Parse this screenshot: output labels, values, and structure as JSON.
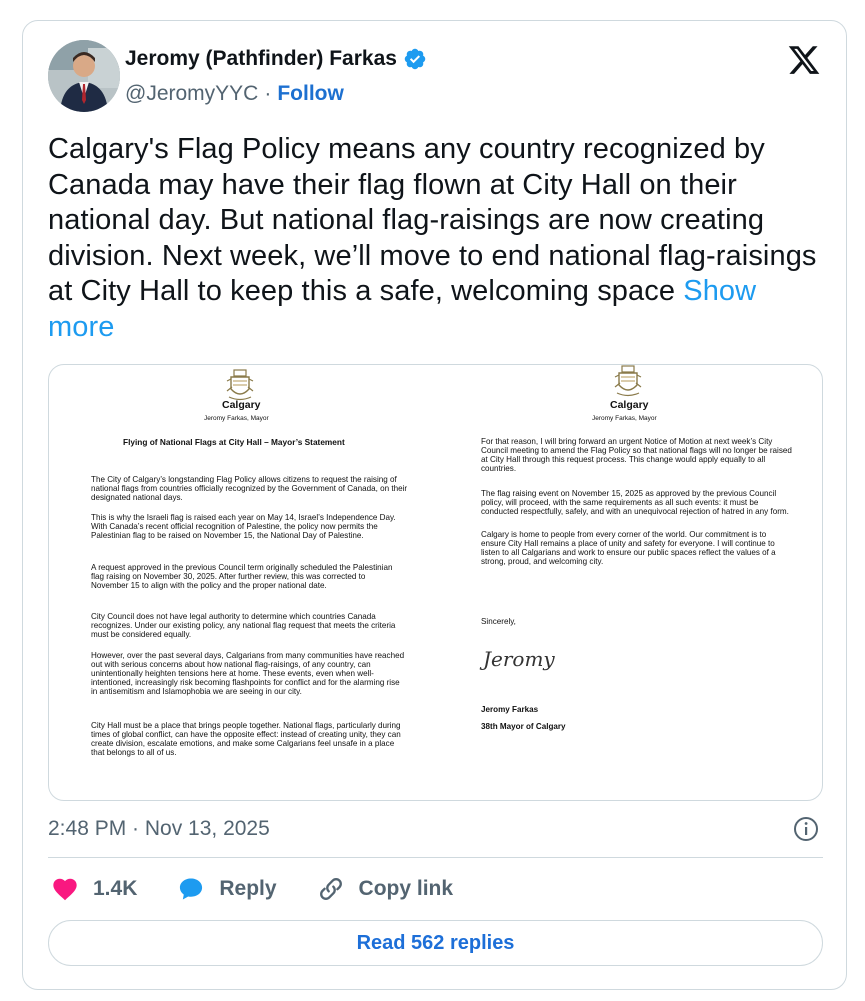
{
  "author": {
    "name": "Jeromy (Pathfinder) Farkas",
    "handle": "@JeromyYYC",
    "separator": "·",
    "follow_label": "Follow"
  },
  "tweet": {
    "text": "Calgary's Flag Policy means any country recognized by Canada may have their flag flown at City Hall on their national day. But national flag-raisings are now creating division. Next week, we’ll move to end national flag-raisings at City Hall to keep this a safe, welcoming space",
    "show_more": "Show more"
  },
  "document": {
    "city": "Calgary",
    "mayor_line": "Jeromy Farkas, Mayor",
    "title": "Flying of National Flags at City Hall – Mayor’s Statement",
    "left_paragraphs": [
      "The City of Calgary’s longstanding Flag Policy allows citizens to request the raising of national flags from countries officially recognized by the Government of Canada, on their designated national days.",
      "This is why the Israeli flag is raised each year on May 14, Israel’s Independence Day. With Canada’s recent official recognition of Palestine, the policy now permits the Palestinian flag to be raised on November 15, the National Day of Palestine.",
      "A request approved in the previous Council term originally scheduled the Palestinian flag raising on November 30, 2025. After further review, this was corrected to November 15 to align with the policy and the proper national date.",
      "City Council does not have legal authority to determine which countries Canada recognizes. Under our existing policy, any national flag request that meets the criteria must be considered equally.",
      "However, over the past several days, Calgarians from many communities have reached out with serious concerns about how national flag-raisings, of any country, can unintentionally heighten tensions here at home. These events, even when well-intentioned, increasingly risk becoming flashpoints for conflict and for the alarming rise in antisemitism and Islamophobia we are seeing in our city.",
      "City Hall must be a place that brings people together. National flags, particularly during times of global conflict, can have the opposite effect: instead of creating unity, they can create division, escalate emotions, and make some Calgarians feel unsafe in a place that belongs to all of us."
    ],
    "right_paragraphs": [
      "For that reason, I will bring forward an urgent Notice of Motion at next week’s City Council meeting to amend the Flag Policy so that national flags will no longer be raised at City Hall through this request process. This change would apply equally to all countries.",
      "The flag raising event on November 15, 2025 as approved by the previous Council policy, will proceed, with the same requirements as all such events: it must be conducted respectfully, safely, and with an unequivocal rejection of hatred in any form.",
      "Calgary is home to people from every corner of the world. Our commitment is to ensure City Hall remains a place of unity and safety for everyone. I will continue to listen to all Calgarians and work to ensure our public spaces reflect the values of a strong, proud, and welcoming city."
    ],
    "closing": "Sincerely,",
    "signature": "Jeromy",
    "signer_name": "Jeromy Farkas",
    "signer_title": "38th Mayor of Calgary"
  },
  "meta": {
    "timestamp": "2:48 PM · Nov 13, 2025"
  },
  "actions": {
    "like_count": "1.4K",
    "reply_label": "Reply",
    "copy_link_label": "Copy link",
    "read_replies_label": "Read 562 replies"
  },
  "colors": {
    "like": "#f91880",
    "reply": "#1d9bf0",
    "link_blue": "#1d9bf0",
    "verified": "#1d9bf0"
  },
  "icons": {
    "verified": "verified-badge-icon",
    "brand": "x-logo-icon",
    "info": "info-icon",
    "like": "heart-icon",
    "reply": "speech-bubble-icon",
    "copy_link": "link-icon",
    "crest": "city-crest-icon"
  }
}
